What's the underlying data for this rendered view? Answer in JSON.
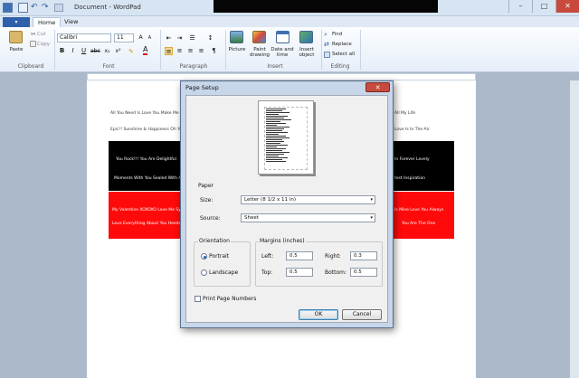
{
  "window": {
    "title": "Document - WordPad",
    "controls": {
      "minimize": "–",
      "maximize": "□",
      "close": "✕"
    }
  },
  "quick_access": {
    "icons": [
      "save-icon",
      "undo-icon",
      "redo-icon",
      "customize-icon"
    ]
  },
  "tabs": {
    "file": "▾",
    "home": "Home",
    "view": "View"
  },
  "ribbon": {
    "clipboard": {
      "paste": "Paste",
      "cut": "Cut",
      "copy": "Copy",
      "label": "Clipboard"
    },
    "font": {
      "family": "Calibri",
      "size": "11",
      "label": "Font"
    },
    "paragraph": {
      "label": "Paragraph"
    },
    "insert": {
      "picture": "Picture",
      "paint": "Paint drawing",
      "datetime": "Date and time",
      "object": "Insert object",
      "label": "Insert"
    },
    "editing": {
      "find": "Find",
      "replace": "Replace",
      "select_all": "Select all",
      "label": "Editing"
    }
  },
  "document": {
    "line1_left": "All You Need Is Love   You Make Me",
    "line1_right": "All My Life",
    "line2_left": "Epic!!    Sunshine & Happiness    Oh Yo",
    "line2_right": "Love Is In The Air",
    "black_band": {
      "row1_left": "You Rock!!!     You Are Delightful",
      "row1_right": "In Forever     Lovely",
      "row2_left": "Moments With You     Sealed With A Ki",
      "row2_right": "test     Inspiration"
    },
    "red_band": {
      "row1_left": "My Valentine     XOXOXO     Love Me Sy",
      "row1_right": "Is Mine     Love You Always",
      "row2_left": "Love Everything About You     Heedon",
      "row2_right": "You Are The One"
    }
  },
  "dialog": {
    "title": "Page Setup",
    "close": "✕",
    "paper_label": "Paper",
    "size_label": "Size:",
    "size_value": "Letter (8 1/2 x 11 in)",
    "source_label": "Source:",
    "source_value": "Sheet",
    "orientation_label": "Orientation",
    "portrait": "Portrait",
    "landscape": "Landscape",
    "orientation_selected": "Portrait",
    "margins_label": "Margins (inches)",
    "left_label": "Left:",
    "left_value": "0.5",
    "right_label": "Right:",
    "right_value": "0.3",
    "top_label": "Top:",
    "top_value": "0.5",
    "bottom_label": "Bottom:",
    "bottom_value": "0.5",
    "print_page_numbers": "Print Page Numbers",
    "ok": "OK",
    "cancel": "Cancel"
  }
}
